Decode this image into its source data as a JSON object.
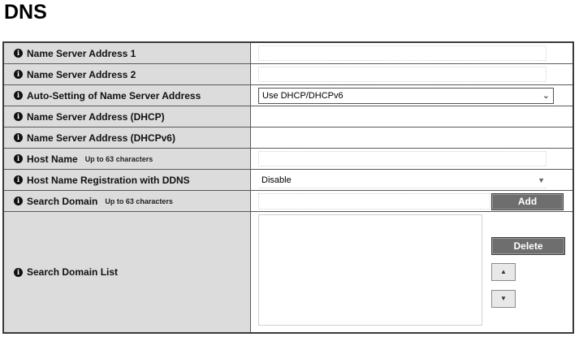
{
  "page": {
    "title": "DNS"
  },
  "rows": {
    "ns1": {
      "label": "Name Server Address 1",
      "value": ""
    },
    "ns2": {
      "label": "Name Server Address 2",
      "value": ""
    },
    "auto": {
      "label": "Auto-Setting of Name Server Address",
      "selected": "Use DHCP/DHCPv6"
    },
    "dhcp": {
      "label": "Name Server Address (DHCP)",
      "value": ""
    },
    "dhcpv6": {
      "label": "Name Server Address (DHCPv6)",
      "value": ""
    },
    "hostname": {
      "label": "Host Name",
      "note": "Up to 63 characters",
      "value": ""
    },
    "ddns": {
      "label": "Host Name Registration with DDNS",
      "selected": "Disable"
    },
    "search_domain": {
      "label": "Search Domain",
      "note": "Up to 63 characters",
      "value": "",
      "add_label": "Add"
    },
    "search_list": {
      "label": "Search Domain List",
      "delete_label": "Delete",
      "up_glyph": "▲",
      "down_glyph": "▼",
      "items": []
    }
  },
  "icons": {
    "info": "info-icon",
    "caret": "chevron-down-icon"
  },
  "colors": {
    "label_bg": "#dcdcdc",
    "button_dark": "#6e6e6e"
  }
}
